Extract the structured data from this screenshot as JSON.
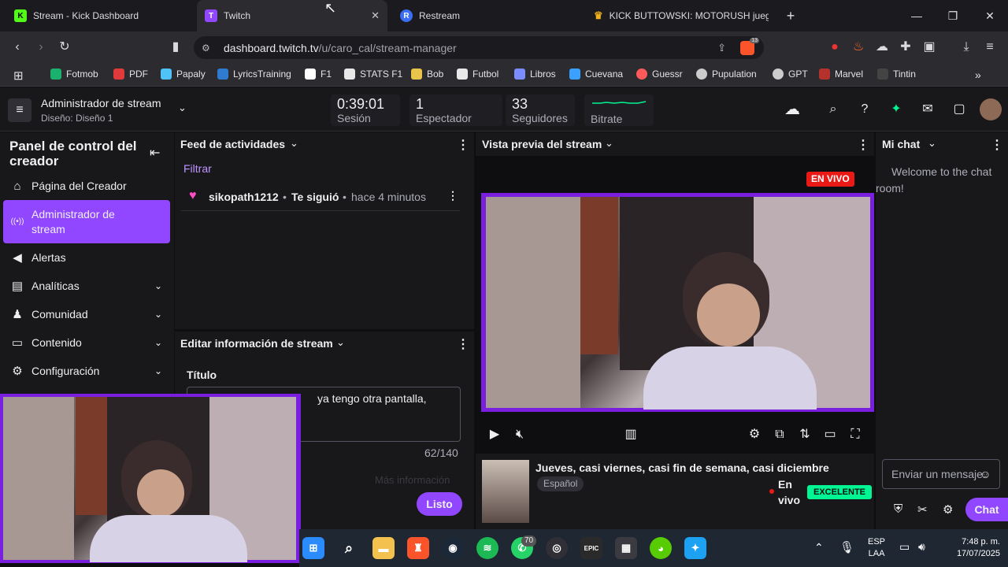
{
  "browser": {
    "tabs": [
      {
        "label": "Stream - Kick Dashboard",
        "icon": "K",
        "color": "#53fc18"
      },
      {
        "label": "Twitch",
        "icon": "T",
        "color": "#9147ff"
      },
      {
        "label": "Restream",
        "icon": "R",
        "color": "#3b6ef5"
      },
      {
        "label": "KICK BUTTOWSKI: MOTORUSH juego",
        "icon": "♛",
        "color": "#f2b01e"
      }
    ],
    "new_tab": "+",
    "url_host": "dashboard.twitch.tv",
    "url_path": "/u/caro_cal/stream-manager",
    "brave_badge": "13",
    "bookmarks": [
      {
        "label": "Fotmob",
        "color": "#1ab06e"
      },
      {
        "label": "PDF",
        "color": "#e03a3a"
      },
      {
        "label": "Papaly",
        "color": "#4fc3f7"
      },
      {
        "label": "LyricsTraining",
        "color": "#2e7bcf"
      },
      {
        "label": "F1",
        "color": "#ffffff"
      },
      {
        "label": "STATS F1",
        "color": "#e8e8e8"
      },
      {
        "label": "Bob",
        "color": "#e8c44b"
      },
      {
        "label": "Futbol",
        "color": "#e8e8e8"
      },
      {
        "label": "Libros",
        "color": "#7b8cff"
      },
      {
        "label": "Cuevana",
        "color": "#3aa1ff"
      },
      {
        "label": "Guessr",
        "color": "#ff5a5a"
      },
      {
        "label": "Pupulation",
        "color": "#cccccc"
      },
      {
        "label": "GPT",
        "color": "#cccccc"
      },
      {
        "label": "Marvel",
        "color": "#b5312b"
      },
      {
        "label": "Tintin",
        "color": "#444444"
      }
    ]
  },
  "header": {
    "title": "Administrador de stream",
    "subtitle": "Diseño: Diseño 1",
    "stats": [
      {
        "value": "0:39:01",
        "label": "Sesión"
      },
      {
        "value": "1",
        "label": "Espectador"
      },
      {
        "value": "33",
        "label": "Seguidores"
      },
      {
        "value": "",
        "label": "Bitrate"
      }
    ]
  },
  "sidebar": {
    "title": "Panel de control del creador",
    "items": [
      {
        "label": "Página del Creador",
        "icon": "⌂"
      },
      {
        "label": "Administrador de stream",
        "icon": "((•))"
      },
      {
        "label": "Alertas",
        "icon": "◀"
      },
      {
        "label": "Analíticas",
        "icon": "▤"
      },
      {
        "label": "Comunidad",
        "icon": "♟"
      },
      {
        "label": "Contenido",
        "icon": "▭"
      },
      {
        "label": "Configuración",
        "icon": "⚙"
      }
    ]
  },
  "activity": {
    "title": "Feed de actividades",
    "filter": "Filtrar",
    "event": {
      "user": "sikopath1212",
      "action": "Te siguió",
      "time": "hace 4 minutos"
    }
  },
  "edit_info": {
    "title": "Editar información de stream",
    "field_label": "Título",
    "title_value": "ya tengo otra pantalla,",
    "counter": "62/140",
    "more": "Más información",
    "done": "Listo"
  },
  "preview": {
    "title": "Vista previa del stream",
    "live_badge": "EN VIVO",
    "stream_title": "Jueves, casi viernes, casi fin de semana, casi diciembre",
    "language": "Español",
    "status": "En vivo",
    "quality": "EXCELENTE"
  },
  "chat": {
    "title": "Mi chat",
    "welcome": "Welcome to the chat room!",
    "placeholder": "Enviar un mensaje",
    "send": "Chat"
  },
  "taskbar": {
    "lang": "ESP",
    "region": "LAA",
    "time": "7:48 p. m.",
    "date": "17/07/2025",
    "whatsapp_badge": "70"
  }
}
